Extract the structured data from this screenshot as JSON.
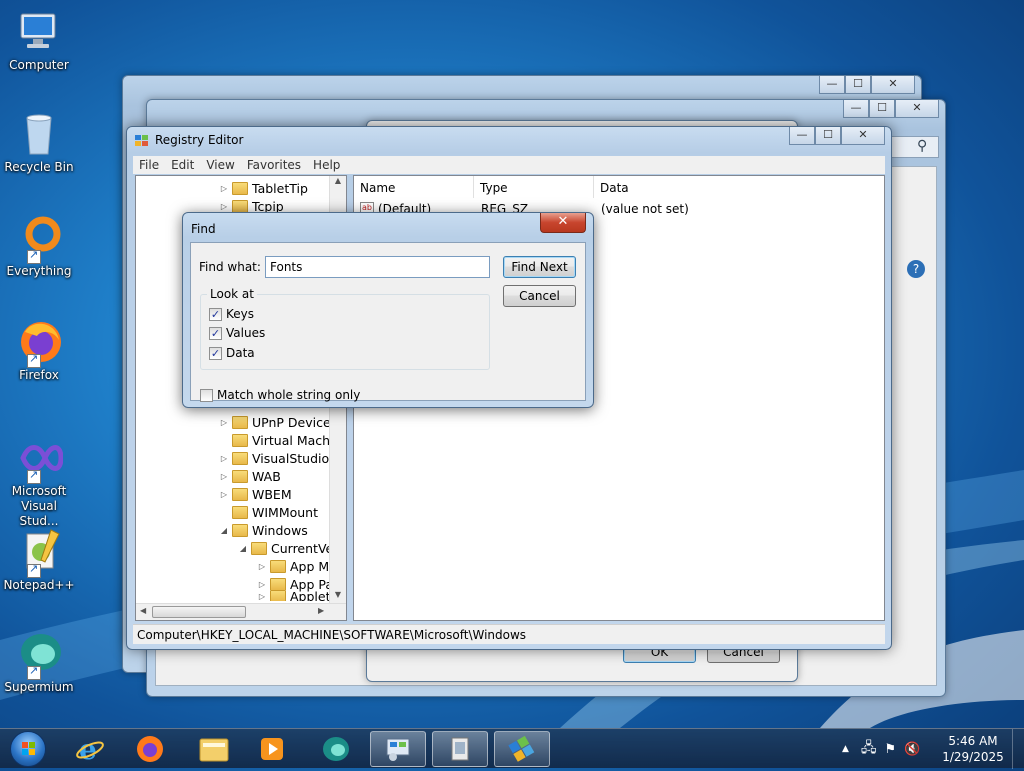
{
  "desktop": {
    "icons": [
      {
        "label": "Computer"
      },
      {
        "label": "Recycle Bin"
      },
      {
        "label": "Everything"
      },
      {
        "label": "Firefox"
      },
      {
        "label": "Microsoft Visual Stud..."
      },
      {
        "label": "Notepad++"
      },
      {
        "label": "Supermium"
      }
    ]
  },
  "registry_editor": {
    "title": "Registry Editor",
    "menu": [
      "File",
      "Edit",
      "View",
      "Favorites",
      "Help"
    ],
    "tree": [
      {
        "label": "TabletTip",
        "expand": "▷"
      },
      {
        "label": "Tcpip",
        "expand": "▷"
      },
      {
        "label": "UPnP Device H",
        "expand": "▷"
      },
      {
        "label": "Virtual Machin",
        "expand": ""
      },
      {
        "label": "VisualStudio",
        "expand": "▷"
      },
      {
        "label": "WAB",
        "expand": "▷"
      },
      {
        "label": "WBEM",
        "expand": "▷"
      },
      {
        "label": "WIMMount",
        "expand": ""
      },
      {
        "label": "Windows",
        "expand": "◢"
      },
      {
        "label": "CurrentVer",
        "expand": "◢"
      },
      {
        "label": "App M",
        "expand": "▷"
      },
      {
        "label": "App Pa",
        "expand": "▷"
      },
      {
        "label": "Applets",
        "expand": "▷"
      }
    ],
    "columns": {
      "name": "Name",
      "type": "Type",
      "data": "Data"
    },
    "rows": [
      {
        "name": "(Default)",
        "type": "REG_SZ",
        "data": "(value not set)"
      }
    ],
    "status_path": "Computer\\HKEY_LOCAL_MACHINE\\SOFTWARE\\Microsoft\\Windows"
  },
  "find_dialog": {
    "title": "Find",
    "find_what_label": "Find what:",
    "find_what_value": "Fonts",
    "find_next_label": "Find Next",
    "cancel_label": "Cancel",
    "look_at_label": "Look at",
    "keys_label": "Keys",
    "keys_checked": true,
    "values_label": "Values",
    "values_checked": true,
    "data_label": "Data",
    "data_checked": true,
    "match_whole_label": "Match whole string only",
    "match_whole_checked": false
  },
  "background_dialog": {
    "ok_label": "OK",
    "cancel_label": "Cancel"
  },
  "taskbar": {
    "clock_time": "5:46 AM",
    "clock_date": "1/29/2025"
  },
  "colors": {
    "wallpaper": "#1f7fc9",
    "close_red": "#c8452e",
    "taskbar": "#1e3c5f"
  }
}
